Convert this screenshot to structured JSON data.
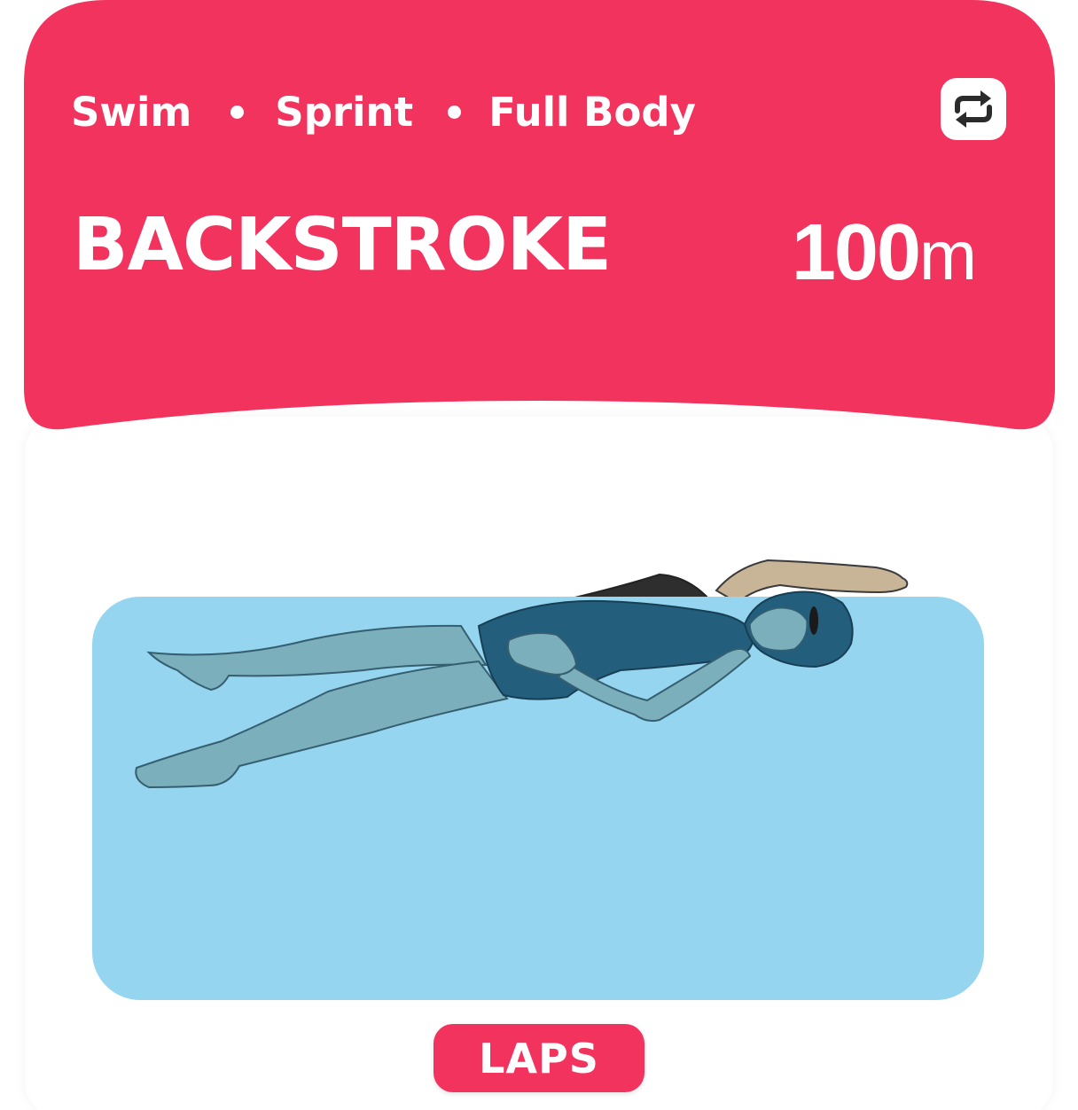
{
  "workout": {
    "tags": [
      "Swim",
      "Sprint",
      "Full Body"
    ],
    "title": "BACKSTROKE",
    "distance_value": "100",
    "distance_unit": "m"
  },
  "controls": {
    "repeat_icon": "repeat-icon",
    "laps_label": "LAPS"
  },
  "colors": {
    "accent": "#f2335d",
    "water": "#96d5f0",
    "swimsuit": "#235f7d",
    "skin": "#c8b497",
    "background": "#ffffff"
  },
  "illustration": {
    "subject": "swimmer-backstroke"
  }
}
